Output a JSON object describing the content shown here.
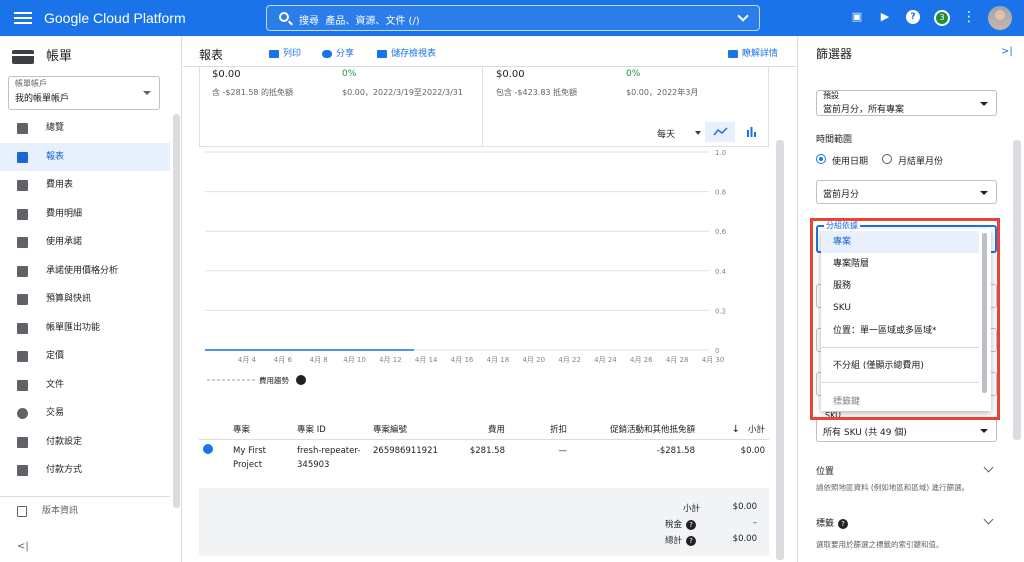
{
  "topbar": {
    "brand": "Google Cloud Platform",
    "search_label": "搜尋",
    "search_hint": "產品、資源、文件 (/)",
    "notification_count": "3",
    "icons": [
      "gift-icon",
      "terminal-icon",
      "help-icon",
      "more-vert-icon"
    ]
  },
  "sidebar": {
    "title": "帳單",
    "account_label": "帳單帳戶",
    "account_value": "我的帳單帳戶",
    "items": [
      {
        "label": "總覽",
        "icon": "dashboard-icon"
      },
      {
        "label": "報表",
        "icon": "bar-chart-icon",
        "active": true
      },
      {
        "label": "費用表",
        "icon": "table-icon"
      },
      {
        "label": "費用明細",
        "icon": "breakdown-icon"
      },
      {
        "label": "使用承諾",
        "icon": "list-icon"
      },
      {
        "label": "承諾使用價格分析",
        "icon": "analysis-icon"
      },
      {
        "label": "預算與快訊",
        "icon": "budget-icon"
      },
      {
        "label": "帳單匯出功能",
        "icon": "export-icon"
      },
      {
        "label": "定價",
        "icon": "tag-icon"
      },
      {
        "label": "文件",
        "icon": "documents-icon"
      },
      {
        "label": "交易",
        "icon": "history-icon"
      },
      {
        "label": "付款設定",
        "icon": "person-icon"
      },
      {
        "label": "付款方式",
        "icon": "credit-card-icon"
      }
    ],
    "release_notes": "版本資訊",
    "collapse": "<|"
  },
  "main": {
    "title": "報表",
    "actions": {
      "print": "列印",
      "share": "分享",
      "save_view": "儲存檢視表",
      "learn": "瞭解詳情"
    },
    "summary": {
      "left_amount": "$0.00",
      "left_sub": "含 -$281.58 的抵免額",
      "left_pct": "0%",
      "left_pct_sub": "$0.00，2022/3/19至2022/3/31",
      "right_amount": "$0.00",
      "right_sub": "包含 -$423.83 抵免額",
      "right_pct": "0%",
      "right_pct_sub": "$0.00，2022年3月"
    },
    "chart_toggle": {
      "granularity": "每天"
    },
    "legend_label": "費用趨勢",
    "table": {
      "headers": [
        "專案",
        "專案 ID",
        "專案編號",
        "費用",
        "折扣",
        "促銷活動和其他抵免額",
        "小計"
      ],
      "sort_indicator": "↓",
      "rows": [
        {
          "project": "My First Project",
          "id": "fresh-repeater-345903",
          "number": "265986911921",
          "cost": "$281.58",
          "discount": "—",
          "credits": "-$281.58",
          "subtotal": "$0.00"
        }
      ]
    },
    "totals": {
      "subtotal_label": "小計",
      "subtotal_value": "$0.00",
      "tax_label": "稅金",
      "tax_value": "–",
      "total_label": "總計",
      "total_value": "$0.00"
    }
  },
  "chart_data": {
    "type": "line",
    "x": [
      "4月 4",
      "4月 6",
      "4月 8",
      "4月 10",
      "4月 12",
      "4月 14",
      "4月 16",
      "4月 18",
      "4月 20",
      "4月 22",
      "4月 24",
      "4月 26",
      "4月 28",
      "4月 30"
    ],
    "yticks": [
      "0",
      "0.2",
      "0.4",
      "0.6",
      "0.8",
      "1.0"
    ],
    "ylim": [
      0,
      1.0
    ],
    "series": [
      {
        "name": "費用趨勢",
        "values": [
          0,
          0,
          0,
          0,
          0,
          0
        ]
      }
    ],
    "grid": true
  },
  "filters": {
    "title": "篩選器",
    "preset_label": "預設",
    "preset_value": "當前月分，所有專案",
    "time_range_label": "時間範圍",
    "radio_usage": "使用日期",
    "radio_invoice": "月結單月份",
    "month_value": "當前月分",
    "group_by_label": "分組依據",
    "group_menu": [
      "專案",
      "專案階層",
      "服務",
      "SKU",
      "位置：單一區域或多區域*",
      "不分組 (僅顯示總費用)",
      "標籤鍵"
    ],
    "sku_label": "SKU",
    "sku_value": "所有 SKU (共 49 個)",
    "location_title": "位置",
    "location_desc": "請依照地區資料 (例如地區和區域) 進行篩選。",
    "labels_title": "標籤",
    "labels_desc": "選取要用於篩選之標籤的索引鍵和值。"
  }
}
